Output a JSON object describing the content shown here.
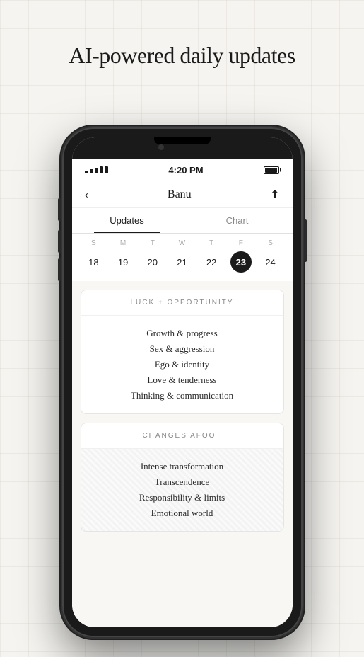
{
  "page": {
    "title": "AI-powered daily updates"
  },
  "status_bar": {
    "signal": "•••••",
    "time": "4:20 PM",
    "battery_label": "battery"
  },
  "nav": {
    "back_icon": "‹",
    "title": "Banu",
    "share_icon": "⬆"
  },
  "tabs": [
    {
      "label": "Updates",
      "active": true
    },
    {
      "label": "Chart",
      "active": false
    }
  ],
  "calendar": {
    "days": [
      "S",
      "M",
      "T",
      "W",
      "T",
      "F",
      "S"
    ],
    "dates": [
      {
        "num": "18",
        "active": false
      },
      {
        "num": "19",
        "active": false
      },
      {
        "num": "20",
        "active": false
      },
      {
        "num": "21",
        "active": false
      },
      {
        "num": "22",
        "active": false
      },
      {
        "num": "23",
        "active": true
      },
      {
        "num": "24",
        "active": false
      }
    ]
  },
  "sections": [
    {
      "id": "luck",
      "header": "LUCK + OPPORTUNITY",
      "striped": false,
      "items": [
        "Growth & progress",
        "Sex & aggression",
        "Ego & identity",
        "Love & tenderness",
        "Thinking & communication"
      ]
    },
    {
      "id": "changes",
      "header": "CHANGES AFOOT",
      "striped": true,
      "items": [
        "Intense transformation",
        "Transcendence",
        "Responsibility & limits",
        "Emotional world"
      ]
    }
  ]
}
